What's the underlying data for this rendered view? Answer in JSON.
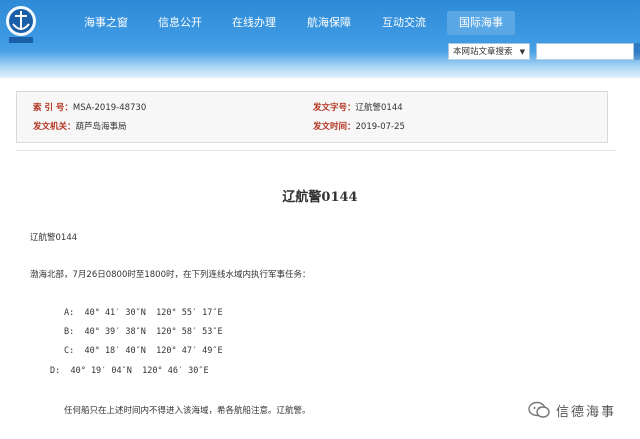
{
  "logo": {
    "icon": "anchor-emblem-icon",
    "colors": {
      "primary": "#1a5fa8",
      "accent": "#ffffff"
    }
  },
  "nav": {
    "items": [
      {
        "label": "海事之窗"
      },
      {
        "label": "信息公开"
      },
      {
        "label": "在线办理"
      },
      {
        "label": "航海保障"
      },
      {
        "label": "互动交流"
      },
      {
        "label": "国际海事"
      }
    ]
  },
  "search": {
    "scope_label": "本网站文章搜索",
    "value": ""
  },
  "meta": {
    "index_label": "索 引 号：",
    "index_value": "MSA-2019-48730",
    "doc_no_label": "发文字号：",
    "doc_no_value": "辽航警0144",
    "issuer_label": "发文机关：",
    "issuer_value": "葫芦岛海事局",
    "date_label": "发文时间：",
    "date_value": "2019-07-25"
  },
  "article": {
    "title": "辽航警0144",
    "code_line": "辽航警0144",
    "intro": "渤海北部，7月26日0800时至1800时，在下列连线水域内执行军事任务：",
    "points": [
      "A:  40° 41′ 30″N  120° 55′ 17″E",
      "B:  40° 39′ 38″N  120° 58′ 53″E",
      "C:  40° 18′ 40″N  120° 47′ 49″E",
      "D:  40° 19′ 04″N  120° 46′ 30″E"
    ],
    "closing": "任何船只在上述时间内不得进入该海域，希各航船注意。辽航警。"
  },
  "watermark": {
    "text": "信德海事",
    "icon": "wechat-icon"
  }
}
